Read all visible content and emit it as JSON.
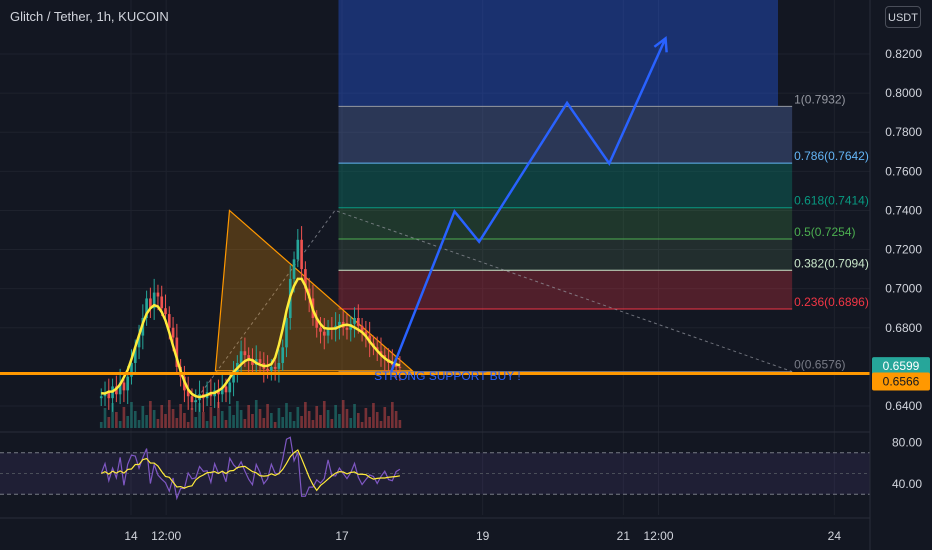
{
  "header": {
    "title": "Glitch / Tether, 1h, KUCOIN",
    "currency": "USDT"
  },
  "chart_data": {
    "type": "candlestick",
    "symbol": "Glitch / Tether",
    "interval": "1h",
    "exchange": "KUCOIN",
    "price_axis": {
      "ylim": [
        0.638,
        0.844
      ],
      "ticks": [
        "0.8200",
        "0.8000",
        "0.7800",
        "0.7600",
        "0.7400",
        "0.7200",
        "0.7000",
        "0.6800",
        "0.6400"
      ]
    },
    "current_price": {
      "label": "0.6599",
      "value": 0.6599,
      "color": "#26a69a"
    },
    "support_price": {
      "label": "0.6566",
      "value": 0.6566,
      "color": "#ff9800"
    },
    "time_axis": {
      "labels": [
        {
          "label": "14",
          "t": 14.0
        },
        {
          "label": "12:00",
          "t": 14.5
        },
        {
          "label": "17",
          "t": 17.0
        },
        {
          "label": "19",
          "t": 19.0
        },
        {
          "label": "21",
          "t": 21.0
        },
        {
          "label": "12:00",
          "t": 21.5
        },
        {
          "label": "24",
          "t": 24.0
        }
      ]
    },
    "fibonacci": {
      "t_start": 16.95,
      "t_end": 23.4,
      "levels": [
        {
          "label": "1(0.7932)",
          "value": 0.7932,
          "color": "#9598a1",
          "fill": "rgba(120,123,134,0.22)"
        },
        {
          "label": "0.786(0.7642)",
          "value": 0.7642,
          "color": "#64b5f6",
          "fill": "rgba(41,98,255,0.18)"
        },
        {
          "label": "0.618(0.7414)",
          "value": 0.7414,
          "color": "#089981",
          "fill": "rgba(8,153,129,0.30)"
        },
        {
          "label": "0.5(0.7254)",
          "value": 0.7254,
          "color": "#4caf50",
          "fill": "rgba(76,175,80,0.22)"
        },
        {
          "label": "0.382(0.7094)",
          "value": 0.7094,
          "color": "#c8e6c9",
          "fill": "rgba(120,180,120,0.15)"
        },
        {
          "label": "0.236(0.6896)",
          "value": 0.6896,
          "color": "#f23645",
          "fill": "rgba(242,54,69,0.28)"
        },
        {
          "label": "0(0.6576)",
          "value": 0.6576,
          "color": "#787b86",
          "fill": ""
        }
      ],
      "top_band_value": 0.844,
      "top_band_color": "rgba(41,98,255,0.35)"
    },
    "projection_path": [
      {
        "t": 17.7,
        "p": 0.6576
      },
      {
        "t": 18.6,
        "p": 0.7395
      },
      {
        "t": 18.95,
        "p": 0.724
      },
      {
        "t": 20.2,
        "p": 0.795
      },
      {
        "t": 20.8,
        "p": 0.764
      },
      {
        "t": 21.6,
        "p": 0.828
      }
    ],
    "projection_color": "#2962ff",
    "annotation": {
      "text": "STRONG SUPPORT BUY !",
      "t": 17.2,
      "p": 0.6538,
      "color": "#2962ff"
    },
    "triangle": [
      {
        "t": 15.4,
        "p": 0.74
      },
      {
        "t": 15.2,
        "p": 0.658
      },
      {
        "t": 18.0,
        "p": 0.658
      }
    ],
    "triangle_color": "#ff9800",
    "support_line_value": 0.6566,
    "trend_line": [
      {
        "t": 14.9,
        "p": 0.642
      },
      {
        "t": 16.9,
        "p": 0.74
      },
      {
        "t": 23.4,
        "p": 0.6576
      }
    ],
    "candles_close": [
      0.645,
      0.647,
      0.644,
      0.65,
      0.646,
      0.652,
      0.648,
      0.655,
      0.662,
      0.67,
      0.676,
      0.685,
      0.695,
      0.69,
      0.698,
      0.696,
      0.69,
      0.687,
      0.68,
      0.675,
      0.66,
      0.655,
      0.648,
      0.645,
      0.642,
      0.643,
      0.646,
      0.644,
      0.647,
      0.645,
      0.648,
      0.646,
      0.65,
      0.647,
      0.652,
      0.656,
      0.662,
      0.668,
      0.666,
      0.664,
      0.661,
      0.664,
      0.662,
      0.659,
      0.658,
      0.66,
      0.659,
      0.662,
      0.67,
      0.685,
      0.705,
      0.715,
      0.725,
      0.71,
      0.7,
      0.695,
      0.685,
      0.68,
      0.678,
      0.676,
      0.68,
      0.679,
      0.681,
      0.683,
      0.68,
      0.679,
      0.682,
      0.685,
      0.681,
      0.678,
      0.676,
      0.672,
      0.67,
      0.668,
      0.666,
      0.664,
      0.662,
      0.661,
      0.66,
      0.6599
    ],
    "rsi": {
      "ticks": [
        "80.00",
        "40.00"
      ],
      "upper": 70,
      "lower": 30
    }
  }
}
